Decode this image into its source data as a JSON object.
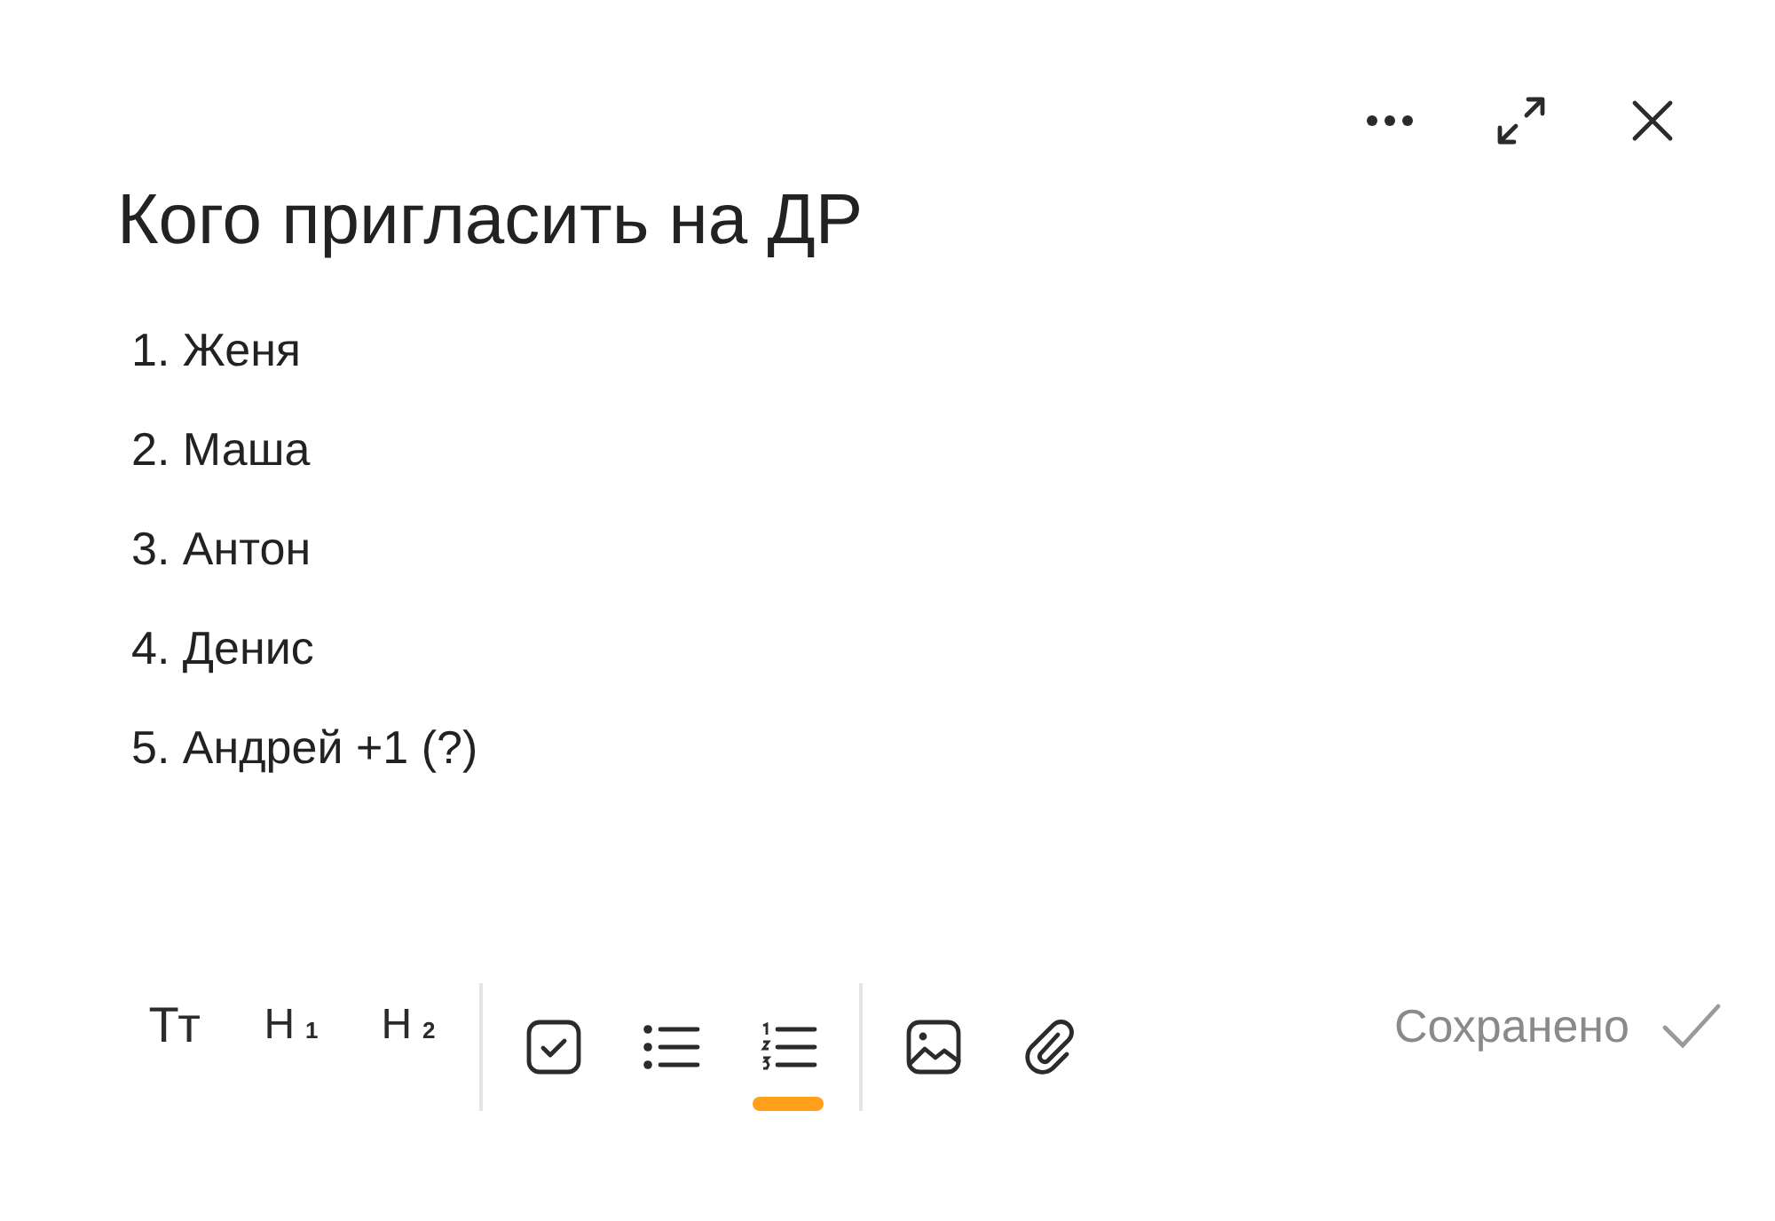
{
  "title": "Кого пригласить на ДР",
  "list": [
    {
      "number": "1.",
      "text": "Женя"
    },
    {
      "number": "2.",
      "text": "Маша"
    },
    {
      "number": "3.",
      "text": "Антон"
    },
    {
      "number": "4.",
      "text": "Денис"
    },
    {
      "number": "5.",
      "text": "Андрей +1 (?)"
    }
  ],
  "toolbar": [
    [
      {
        "kind": "text",
        "label": "Тт",
        "selected": false
      },
      {
        "kind": "heading",
        "label": "H",
        "sub": "1",
        "selected": false
      },
      {
        "kind": "heading",
        "label": "H",
        "sub": "2",
        "selected": false
      }
    ],
    [
      {
        "kind": "checklist",
        "selected": false
      },
      {
        "kind": "bullets",
        "selected": false
      },
      {
        "kind": "numbered",
        "selected": true
      }
    ],
    [
      {
        "kind": "image",
        "selected": false
      },
      {
        "kind": "attach",
        "selected": false
      }
    ]
  ],
  "status": "Сохранено"
}
